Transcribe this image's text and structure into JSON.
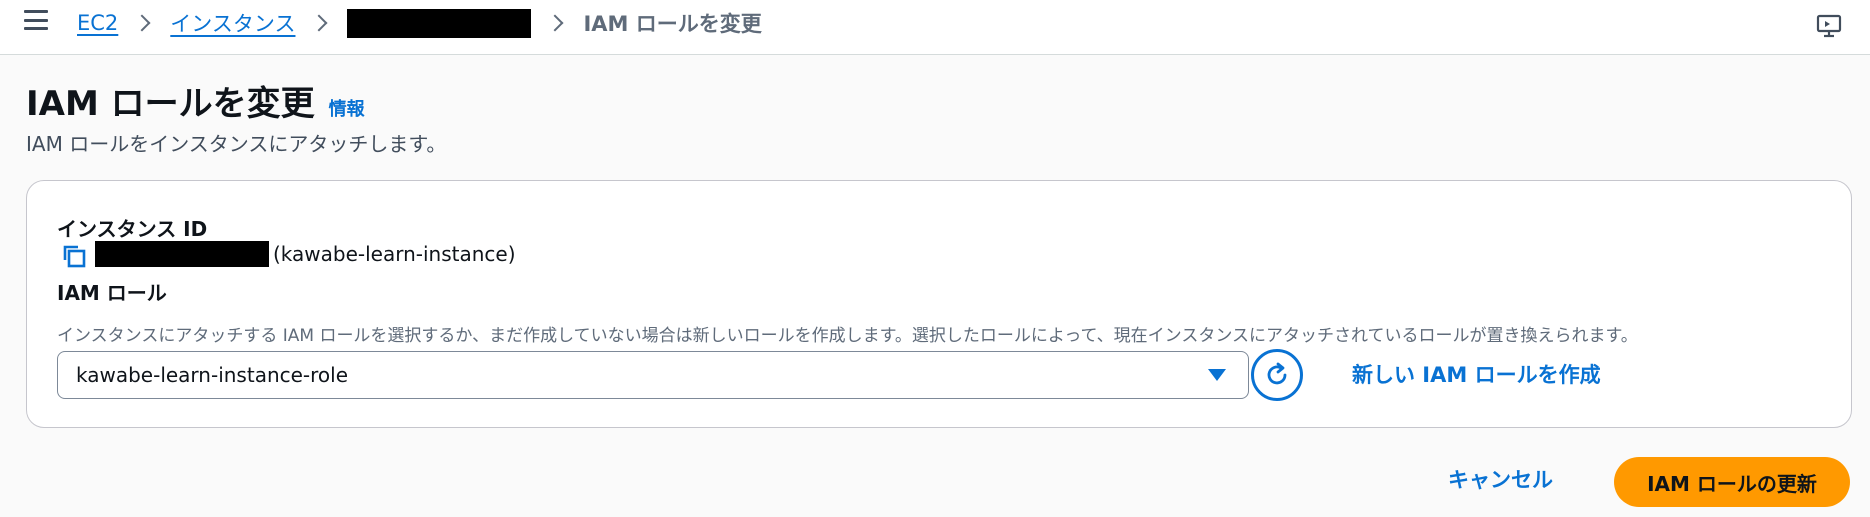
{
  "breadcrumb": {
    "items": [
      "EC2",
      "インスタンス"
    ],
    "current": "IAM ロールを変更"
  },
  "header": {
    "title": "IAM ロールを変更",
    "info_label": "情報",
    "description": "IAM ロールをインスタンスにアタッチします。"
  },
  "form": {
    "instance_id_label": "インスタンス ID",
    "instance_name": "(kawabe-learn-instance)",
    "iam_role_label": "IAM ロール",
    "iam_role_description": "インスタンスにアタッチする IAM ロールを選択するか、まだ作成していない場合は新しいロールを作成します。選択したロールによって、現在インスタンスにアタッチされているロールが置き換えられます。",
    "selected_role": "kawabe-learn-instance-role",
    "create_role_label": "新しい IAM ロールを作成"
  },
  "actions": {
    "cancel_label": "キャンセル",
    "submit_label": "IAM ロールの更新"
  },
  "icons": {
    "menu": "menu-icon",
    "tools": "tools-icon",
    "copy": "copy-icon",
    "refresh": "refresh-icon",
    "dropdown": "caret-down-icon"
  },
  "colors": {
    "link": "#0972d3",
    "primary_button": "#ff9900",
    "text": "#0f141a",
    "secondary_text": "#5f6b7a",
    "redaction": "#000000"
  }
}
